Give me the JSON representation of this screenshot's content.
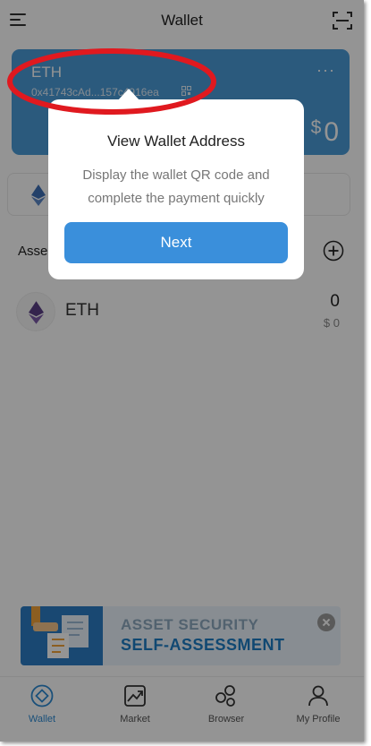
{
  "header": {
    "title": "Wallet",
    "menu_icon": "menu-icon",
    "scan_icon": "scan-icon"
  },
  "wallet_card": {
    "coin_name": "ETH",
    "address": "0x41743cAd...157c4916ea",
    "more": "···",
    "balance_currency": "$",
    "balance_value": "0",
    "card_color": "#4a9bd8"
  },
  "assets": {
    "label": "Asse",
    "items": [
      {
        "name": "ETH",
        "amount": "0",
        "fiat": "$ 0",
        "icon": "ethereum-icon"
      }
    ]
  },
  "banner": {
    "line1": "ASSET SECURITY",
    "line2": "SELF-ASSESSMENT"
  },
  "tabs": [
    {
      "label": "Wallet",
      "icon": "wallet-icon",
      "active": true
    },
    {
      "label": "Market",
      "icon": "market-icon",
      "active": false
    },
    {
      "label": "Browser",
      "icon": "browser-icon",
      "active": false
    },
    {
      "label": "My Profile",
      "icon": "profile-icon",
      "active": false
    }
  ],
  "popup": {
    "title": "View Wallet Address",
    "description": "Display the wallet QR code and complete the payment quickly",
    "next_label": "Next",
    "button_color": "#3a8fdb"
  },
  "annotation": {
    "color": "#e0191f"
  }
}
